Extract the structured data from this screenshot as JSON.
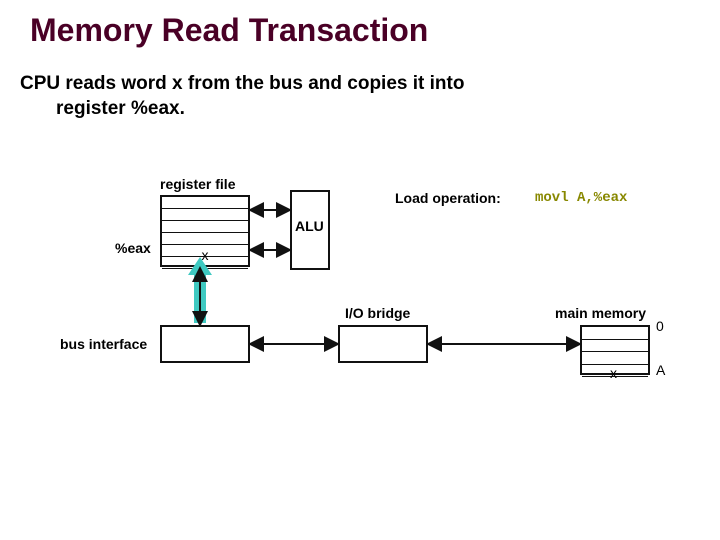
{
  "title": "Memory Read Transaction",
  "subtitle_line1": "CPU reads word x from the bus and copies it into",
  "subtitle_line2": "register %eax.",
  "labels": {
    "register_file": "register file",
    "eax": "%eax",
    "reg_x": "x",
    "alu": "ALU",
    "load_op": "Load operation:",
    "code": "movl A,%eax",
    "io_bridge": "I/O bridge",
    "bus_interface": "bus interface",
    "main_memory": "main memory",
    "mem_0": "0",
    "mem_x": "x",
    "mem_A": "A"
  }
}
